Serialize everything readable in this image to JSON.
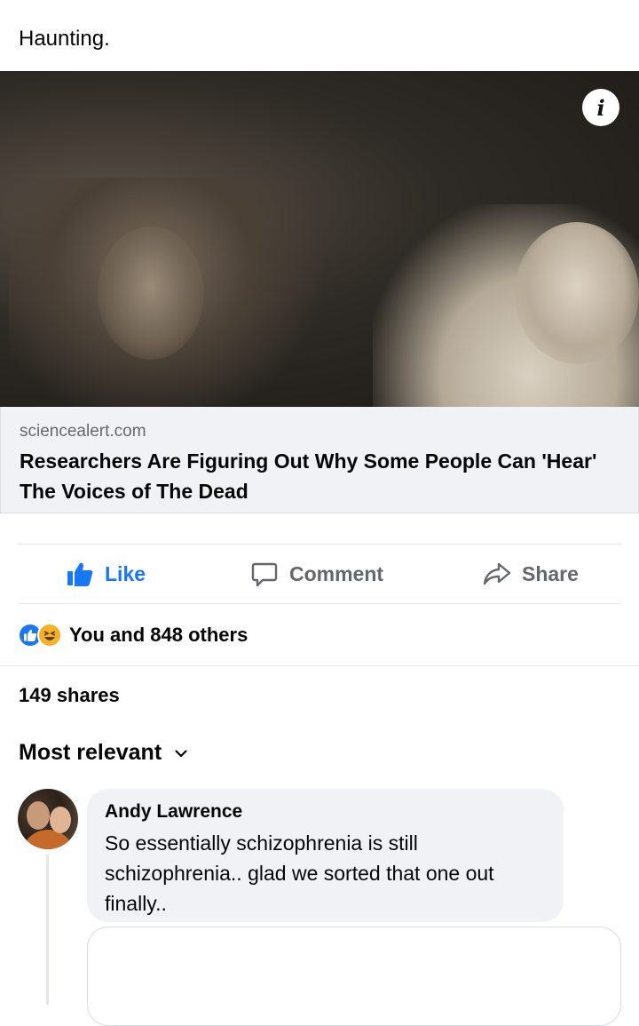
{
  "post": {
    "caption": "Haunting."
  },
  "link_preview": {
    "domain": "sciencealert.com",
    "headline": "Researchers Are Figuring Out Why Some People Can 'Hear' The Voices of The Dead",
    "info_icon": "info-icon"
  },
  "actions": {
    "like_label": "Like",
    "comment_label": "Comment",
    "share_label": "Share"
  },
  "reactions": {
    "summary": "You and 848 others",
    "types": [
      "like",
      "haha"
    ]
  },
  "shares": {
    "label": "149 shares"
  },
  "comments": {
    "sort_label": "Most relevant",
    "items": [
      {
        "author": "Andy Lawrence",
        "text": "So essentially schizophrenia is still schizophrenia.. glad we sorted that one out finally.."
      }
    ]
  },
  "colors": {
    "accent": "#1877f2",
    "muted": "#65676b",
    "bubble": "#f0f2f5"
  }
}
